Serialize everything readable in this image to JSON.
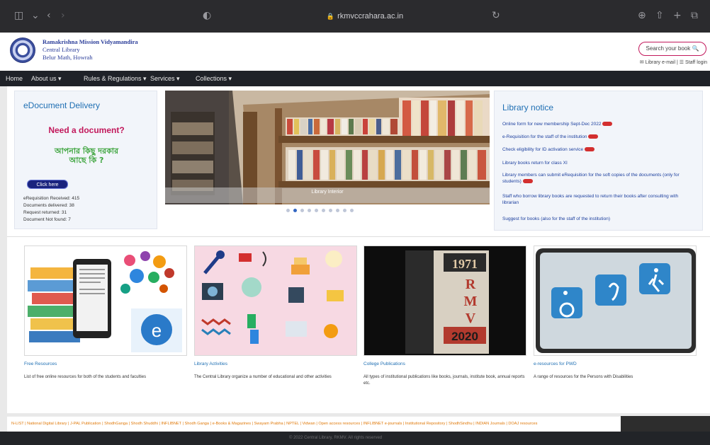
{
  "browser": {
    "url": "rkmvccrahara.ac.in",
    "colors": {
      "chrome": "#2b2b2e"
    }
  },
  "header": {
    "institution_lines": [
      "Ramakrishna Mission Vidyamandira",
      "Central Library",
      "Belur Math, Howrah"
    ],
    "search_label": "Search your book 🔍",
    "links": "✉ Library e-mail  |  ☰ Staff login"
  },
  "nav": {
    "items": [
      "Home",
      "About us ▾",
      "Rules & Regulations ▾",
      "Services ▾",
      "Collections ▾"
    ]
  },
  "edelivery": {
    "title": "eDocument Delivery",
    "need_doc": "Need a document?",
    "bn_lines": [
      "আপনার কিছু দরকার",
      "আছে কি ?"
    ],
    "button": "Click here",
    "stats": [
      "eRequisition Received: 415",
      "Documents delivered: 38",
      "Request returned: 31",
      "Document Not found: 7"
    ]
  },
  "slider": {
    "caption": "Library Interior",
    "dot_count": 10,
    "active_dot": 1
  },
  "notices": {
    "title": "Library notice",
    "items": [
      {
        "text": "Online form for new membership Sept-Dec 2022",
        "new": true
      },
      {
        "text": "e-Requisition for the staff of the institution",
        "new": true
      },
      {
        "text": "Check eligibility for ID activation service",
        "new": true
      },
      {
        "text": "Library books return for class XI",
        "new": false
      },
      {
        "text": "Library members can submit eRequisition for the soft copies of the documents (only for students)",
        "new": true
      },
      {
        "text": "Staff who borrow library books are requested to return their books after consulting with librarian",
        "new": false
      },
      {
        "text": "Suggest for books (also for the staff of the institution)",
        "new": false
      }
    ]
  },
  "cards": [
    {
      "title": "Free Resources",
      "desc": "List of free online resources for both of the students and faculties"
    },
    {
      "title": "Library Activities",
      "desc": "The Central Library organize a number of educational and other activities"
    },
    {
      "title": "College Publications",
      "desc": "All types of institutional publications like books, journals, institute book, annual reports etc."
    },
    {
      "title": "e-resources for PWD",
      "desc": "A range of resources for the Persons with Disabilities"
    }
  ],
  "ticker": "N-LIST  |  National Digital Library  |  J-PAL Publication  |  ShodhGanga  |  Shodh Shuddhi  |  INFLIBNET  |  Shodh Ganga  |  e-Books & Magazines  |  Swayam Prabha  |  NPTEL  |  Vidwan  |  Open access resources  |  INFLIBNET e-journals  |  Institutional Repository  |  ShodhSindhu  |  INDIAN Journals  |  DOAJ resources",
  "footer": "© 2022 Central Library, RKMV. All rights reserved"
}
